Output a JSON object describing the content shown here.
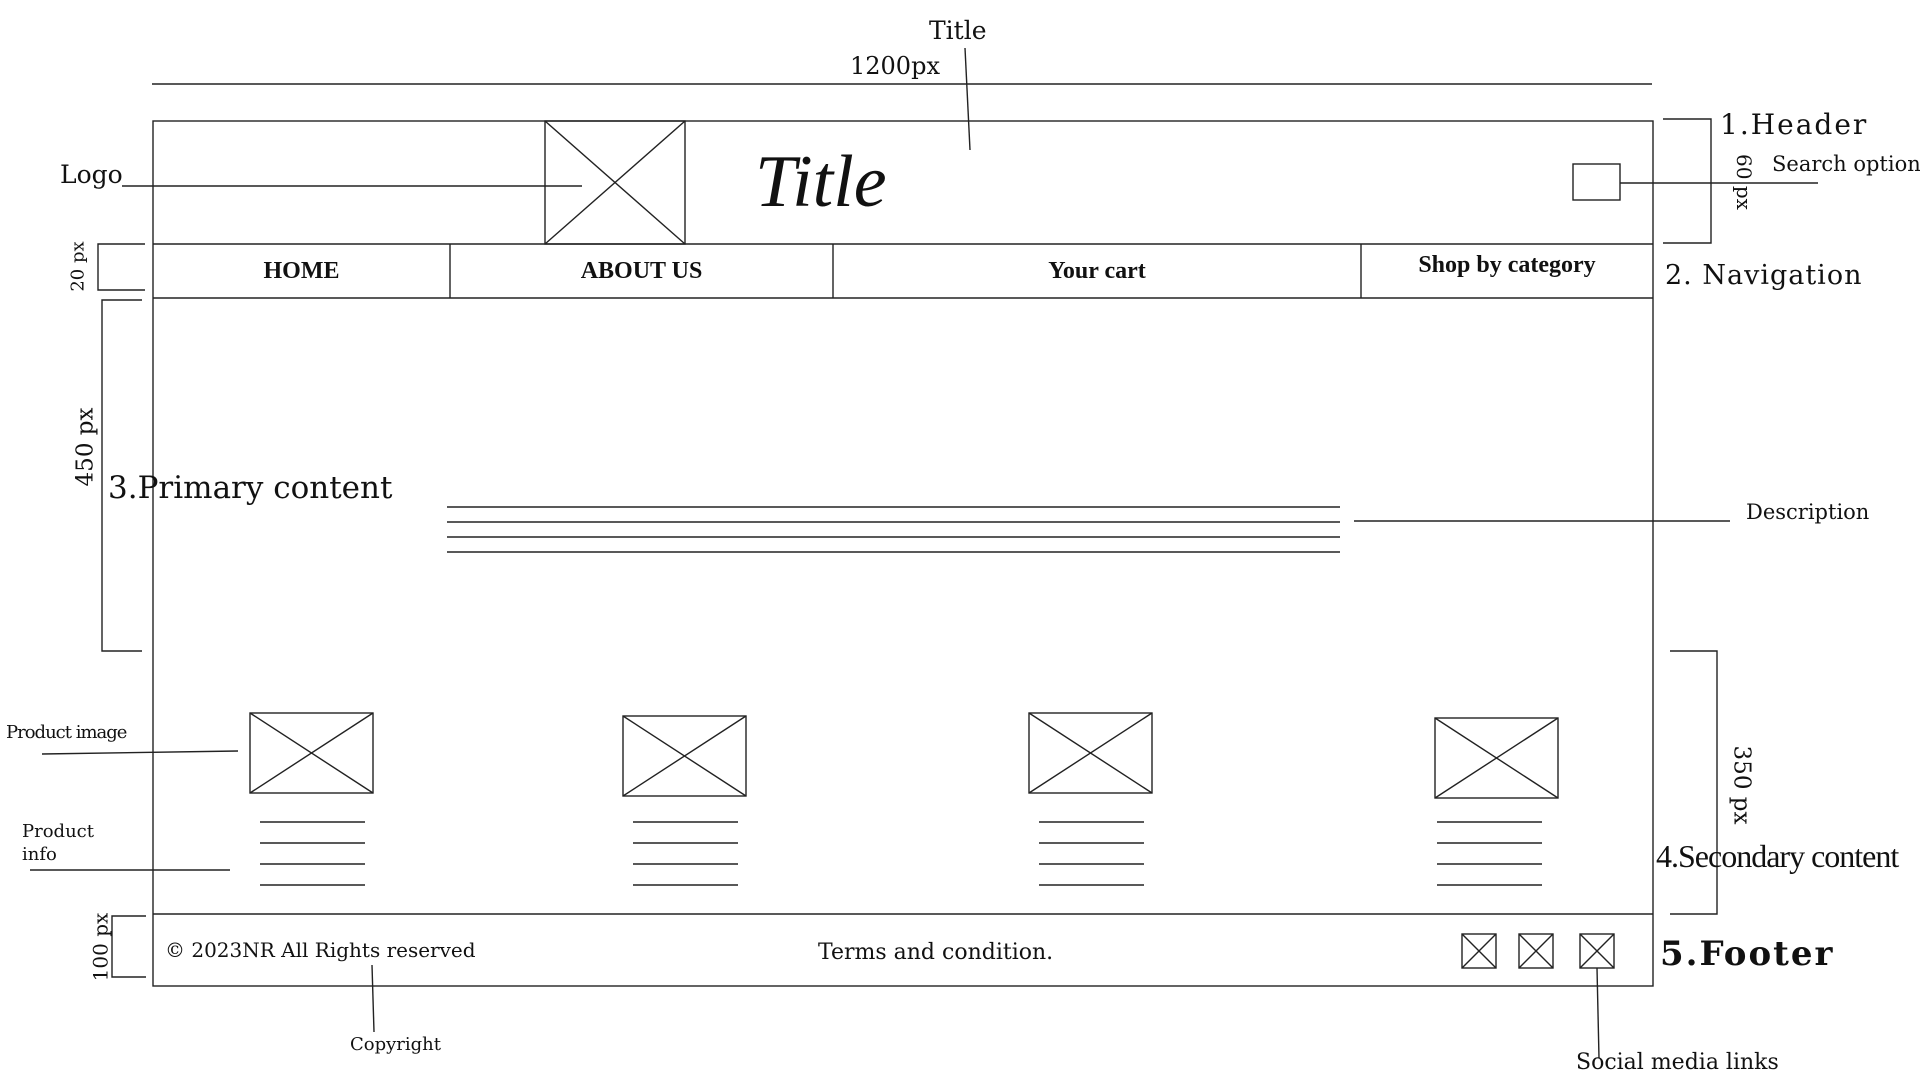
{
  "diagram": {
    "top_title_annotation": "Title",
    "width_annotation": "1200px",
    "header": {
      "title": "Title",
      "section_label": "1.Header",
      "height_label": "60 px"
    },
    "annotations": {
      "logo": "Logo",
      "search_option": "Search option",
      "description": "Description",
      "product_image": "Product image",
      "product_info": "Product info",
      "copyright": "Copyright",
      "social_media_links": "Social media links"
    },
    "navigation": {
      "section_label": "2. Navigation",
      "height_label": "20 px",
      "items": [
        {
          "label": "HOME"
        },
        {
          "label": "ABOUT US"
        },
        {
          "label": "Your cart"
        },
        {
          "label": "Shop by category"
        }
      ]
    },
    "primary": {
      "section_label": "3.Primary content",
      "height_label": "450 px"
    },
    "secondary": {
      "section_label": "4.Secondary content",
      "height_label": "350 px",
      "products": [
        {
          "image": "placeholder"
        },
        {
          "image": "placeholder"
        },
        {
          "image": "placeholder"
        },
        {
          "image": "placeholder"
        }
      ]
    },
    "footer": {
      "section_label": "5.Footer",
      "height_label": "100 px",
      "copyright_text": "© 2023NR All Rights reserved",
      "terms_text": "Terms and condition."
    },
    "icons": {
      "logo": "x-box-placeholder-icon",
      "search": "search-box-icon",
      "social": "x-box-placeholder-icon"
    }
  }
}
